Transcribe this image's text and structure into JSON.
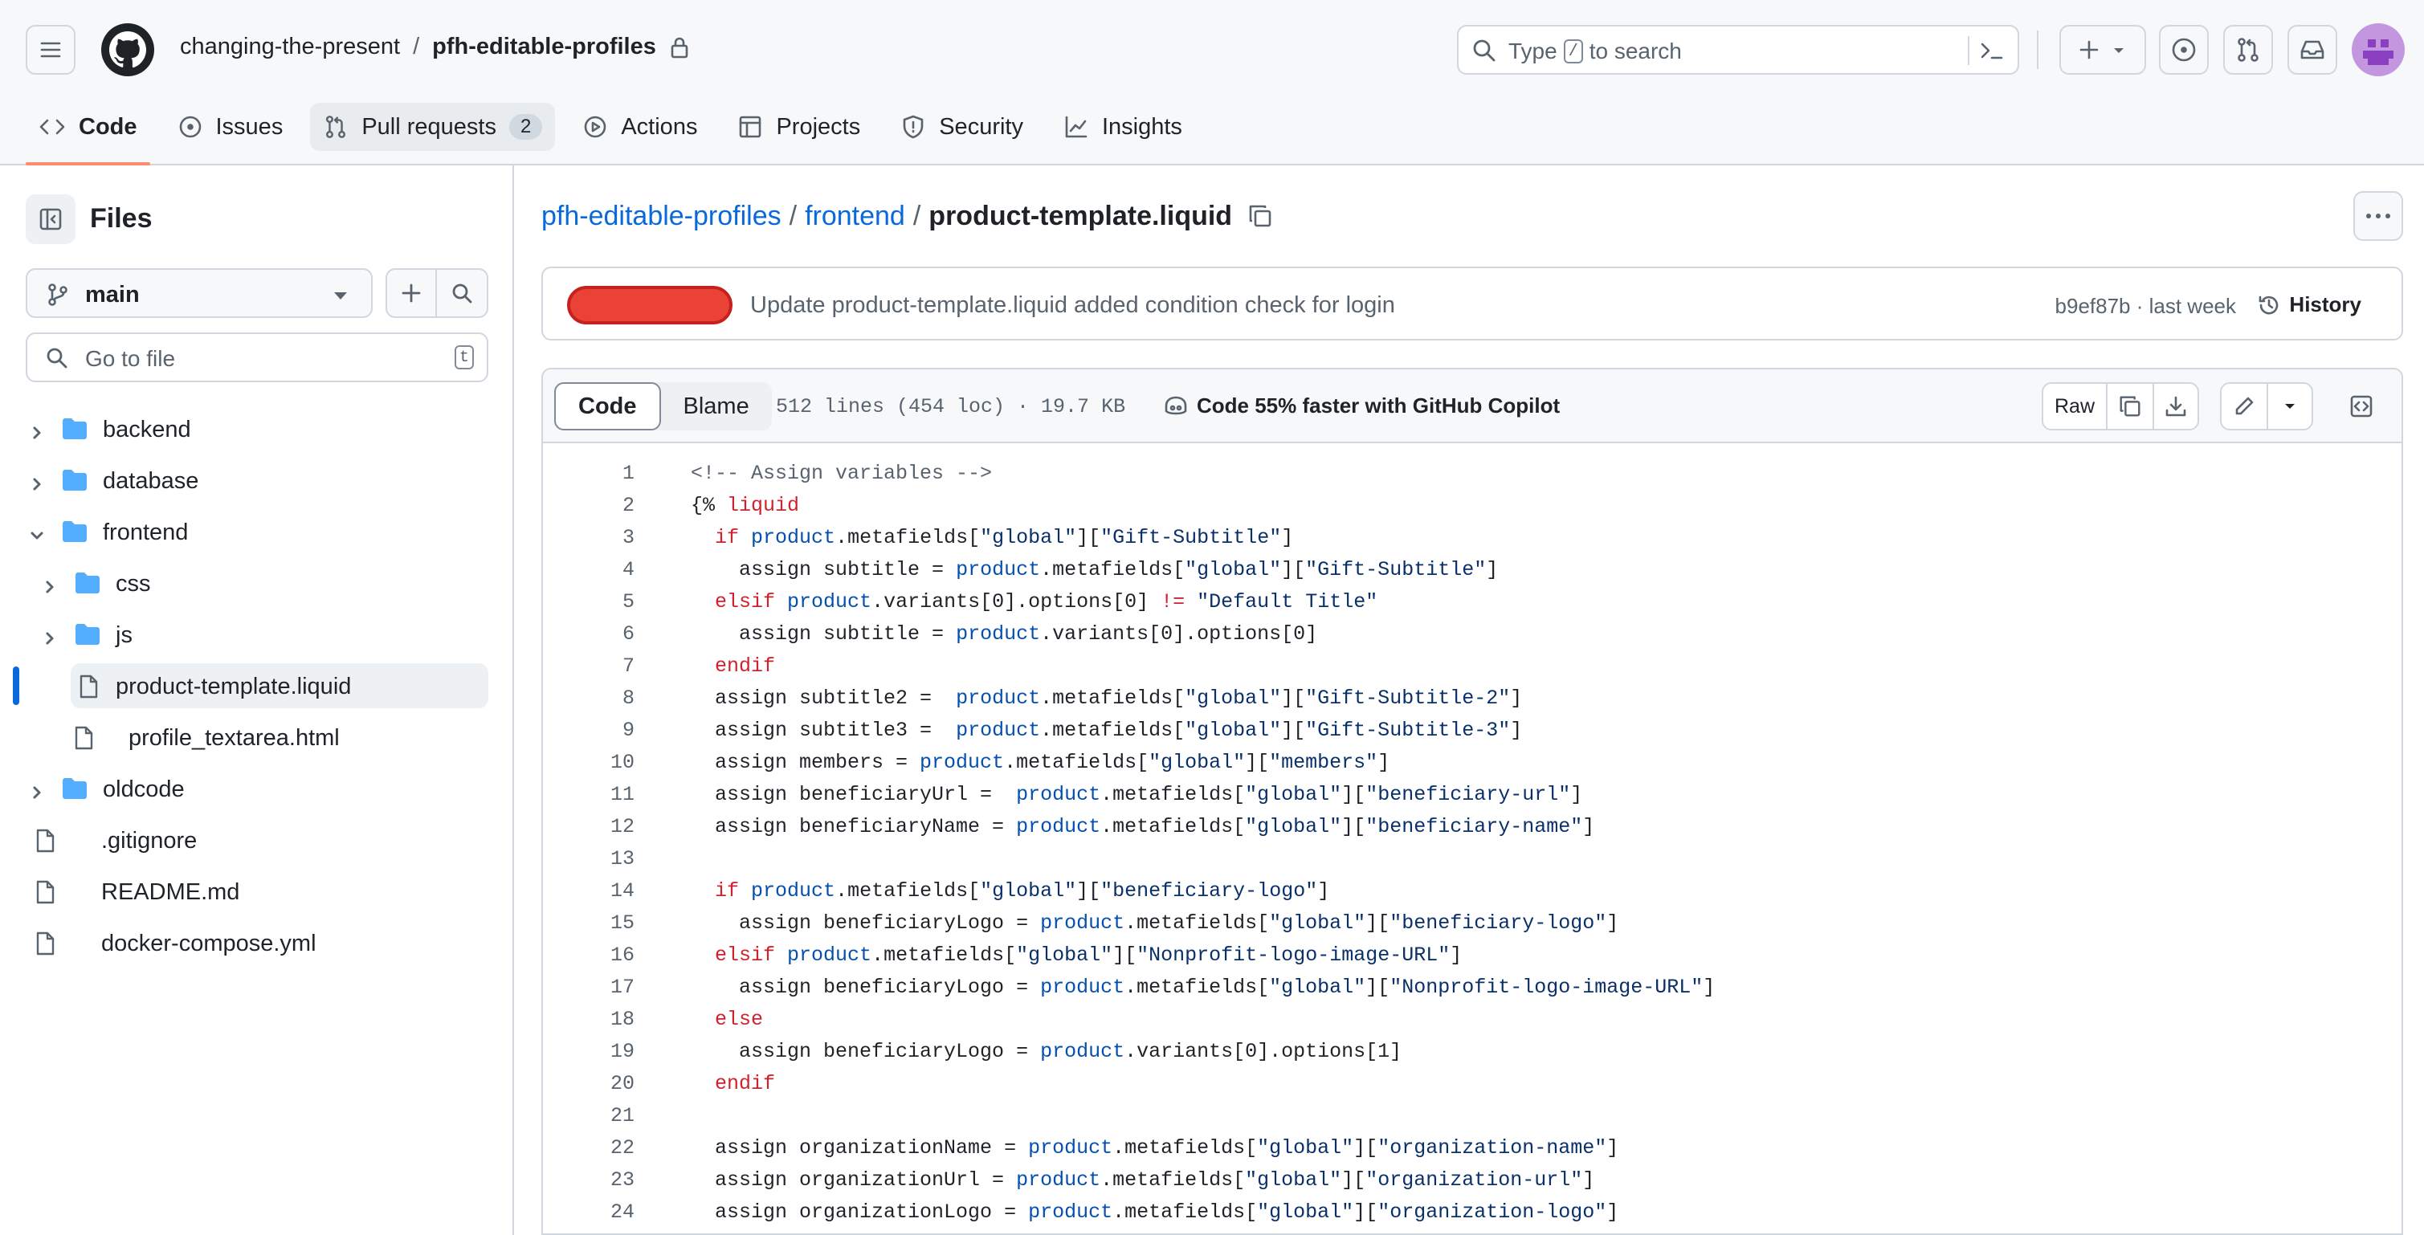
{
  "header": {
    "owner": "changing-the-present",
    "separator": "/",
    "repo": "pfh-editable-profiles",
    "search": {
      "prefix": "Type",
      "key": "/",
      "suffix": "to search"
    }
  },
  "tabs": [
    {
      "label": "Code"
    },
    {
      "label": "Issues"
    },
    {
      "label": "Pull requests",
      "count": "2"
    },
    {
      "label": "Actions"
    },
    {
      "label": "Projects"
    },
    {
      "label": "Security"
    },
    {
      "label": "Insights"
    }
  ],
  "sidebar": {
    "title": "Files",
    "branch": "main",
    "goto_placeholder": "Go to file",
    "goto_key": "t",
    "tree": [
      {
        "label": "backend",
        "type": "folder",
        "expanded": false,
        "depth": 0
      },
      {
        "label": "database",
        "type": "folder",
        "expanded": false,
        "depth": 0
      },
      {
        "label": "frontend",
        "type": "folder",
        "expanded": true,
        "depth": 0
      },
      {
        "label": "css",
        "type": "folder",
        "expanded": false,
        "depth": 1
      },
      {
        "label": "js",
        "type": "folder",
        "expanded": false,
        "depth": 1
      },
      {
        "label": "product-template.liquid",
        "type": "file",
        "selected": true,
        "depth": 1
      },
      {
        "label": "profile_textarea.html",
        "type": "file",
        "depth": 1
      },
      {
        "label": "oldcode",
        "type": "folder",
        "expanded": false,
        "depth": 0
      },
      {
        "label": ".gitignore",
        "type": "file",
        "depth": 0
      },
      {
        "label": "README.md",
        "type": "file",
        "depth": 0
      },
      {
        "label": "docker-compose.yml",
        "type": "file",
        "depth": 0
      }
    ]
  },
  "breadcrumb": {
    "repo": "pfh-editable-profiles",
    "folder": "frontend",
    "file": "product-template.liquid",
    "sep": "/"
  },
  "commit": {
    "message": "Update product-template.liquid added condition check for login",
    "sha_time": "b9ef87b · last week",
    "history": "History"
  },
  "file": {
    "code_tab": "Code",
    "blame_tab": "Blame",
    "meta": "512 lines (454 loc) · 19.7 KB",
    "copilot": "Code 55% faster with GitHub Copilot",
    "raw": "Raw"
  },
  "colors": {
    "accent": "#0969da",
    "tab_underline": "#fd8c73",
    "folder": "#54aeff",
    "keyword": "#cf222e",
    "object": "#0550ae",
    "string": "#0a3069"
  },
  "code_lines": [
    [
      [
        "c",
        "<!-- Assign variables -->"
      ]
    ],
    [
      [
        "p",
        "{% "
      ],
      [
        "k",
        "liquid"
      ]
    ],
    [
      [
        "p",
        "  "
      ],
      [
        "k",
        "if"
      ],
      [
        "p",
        " "
      ],
      [
        "o",
        "product"
      ],
      [
        "p",
        ".metafields["
      ],
      [
        "s",
        "\"global\""
      ],
      [
        "p",
        "]["
      ],
      [
        "s",
        "\"Gift-Subtitle\""
      ],
      [
        "p",
        "]"
      ]
    ],
    [
      [
        "p",
        "    assign subtitle = "
      ],
      [
        "o",
        "product"
      ],
      [
        "p",
        ".metafields["
      ],
      [
        "s",
        "\"global\""
      ],
      [
        "p",
        "]["
      ],
      [
        "s",
        "\"Gift-Subtitle\""
      ],
      [
        "p",
        "]"
      ]
    ],
    [
      [
        "p",
        "  "
      ],
      [
        "k",
        "elsif"
      ],
      [
        "p",
        " "
      ],
      [
        "o",
        "product"
      ],
      [
        "p",
        ".variants[0].options[0] "
      ],
      [
        "k",
        "!="
      ],
      [
        "p",
        " "
      ],
      [
        "s",
        "\"Default Title\""
      ]
    ],
    [
      [
        "p",
        "    assign subtitle = "
      ],
      [
        "o",
        "product"
      ],
      [
        "p",
        ".variants[0].options[0]"
      ]
    ],
    [
      [
        "p",
        "  "
      ],
      [
        "k",
        "endif"
      ]
    ],
    [
      [
        "p",
        "  assign subtitle2 =  "
      ],
      [
        "o",
        "product"
      ],
      [
        "p",
        ".metafields["
      ],
      [
        "s",
        "\"global\""
      ],
      [
        "p",
        "]["
      ],
      [
        "s",
        "\"Gift-Subtitle-2\""
      ],
      [
        "p",
        "]"
      ]
    ],
    [
      [
        "p",
        "  assign subtitle3 =  "
      ],
      [
        "o",
        "product"
      ],
      [
        "p",
        ".metafields["
      ],
      [
        "s",
        "\"global\""
      ],
      [
        "p",
        "]["
      ],
      [
        "s",
        "\"Gift-Subtitle-3\""
      ],
      [
        "p",
        "]"
      ]
    ],
    [
      [
        "p",
        "  assign members = "
      ],
      [
        "o",
        "product"
      ],
      [
        "p",
        ".metafields["
      ],
      [
        "s",
        "\"global\""
      ],
      [
        "p",
        "]["
      ],
      [
        "s",
        "\"members\""
      ],
      [
        "p",
        "]"
      ]
    ],
    [
      [
        "p",
        "  assign beneficiaryUrl =  "
      ],
      [
        "o",
        "product"
      ],
      [
        "p",
        ".metafields["
      ],
      [
        "s",
        "\"global\""
      ],
      [
        "p",
        "]["
      ],
      [
        "s",
        "\"beneficiary-url\""
      ],
      [
        "p",
        "]"
      ]
    ],
    [
      [
        "p",
        "  assign beneficiaryName = "
      ],
      [
        "o",
        "product"
      ],
      [
        "p",
        ".metafields["
      ],
      [
        "s",
        "\"global\""
      ],
      [
        "p",
        "]["
      ],
      [
        "s",
        "\"beneficiary-name\""
      ],
      [
        "p",
        "]"
      ]
    ],
    [
      [
        "p",
        ""
      ]
    ],
    [
      [
        "p",
        "  "
      ],
      [
        "k",
        "if"
      ],
      [
        "p",
        " "
      ],
      [
        "o",
        "product"
      ],
      [
        "p",
        ".metafields["
      ],
      [
        "s",
        "\"global\""
      ],
      [
        "p",
        "]["
      ],
      [
        "s",
        "\"beneficiary-logo\""
      ],
      [
        "p",
        "]"
      ]
    ],
    [
      [
        "p",
        "    assign beneficiaryLogo = "
      ],
      [
        "o",
        "product"
      ],
      [
        "p",
        ".metafields["
      ],
      [
        "s",
        "\"global\""
      ],
      [
        "p",
        "]["
      ],
      [
        "s",
        "\"beneficiary-logo\""
      ],
      [
        "p",
        "]"
      ]
    ],
    [
      [
        "p",
        "  "
      ],
      [
        "k",
        "elsif"
      ],
      [
        "p",
        " "
      ],
      [
        "o",
        "product"
      ],
      [
        "p",
        ".metafields["
      ],
      [
        "s",
        "\"global\""
      ],
      [
        "p",
        "]["
      ],
      [
        "s",
        "\"Nonprofit-logo-image-URL\""
      ],
      [
        "p",
        "]"
      ]
    ],
    [
      [
        "p",
        "    assign beneficiaryLogo = "
      ],
      [
        "o",
        "product"
      ],
      [
        "p",
        ".metafields["
      ],
      [
        "s",
        "\"global\""
      ],
      [
        "p",
        "]["
      ],
      [
        "s",
        "\"Nonprofit-logo-image-URL\""
      ],
      [
        "p",
        "]"
      ]
    ],
    [
      [
        "p",
        "  "
      ],
      [
        "k",
        "else"
      ]
    ],
    [
      [
        "p",
        "    assign beneficiaryLogo = "
      ],
      [
        "o",
        "product"
      ],
      [
        "p",
        ".variants[0].options[1]"
      ]
    ],
    [
      [
        "p",
        "  "
      ],
      [
        "k",
        "endif"
      ]
    ],
    [
      [
        "p",
        ""
      ]
    ],
    [
      [
        "p",
        "  assign organizationName = "
      ],
      [
        "o",
        "product"
      ],
      [
        "p",
        ".metafields["
      ],
      [
        "s",
        "\"global\""
      ],
      [
        "p",
        "]["
      ],
      [
        "s",
        "\"organization-name\""
      ],
      [
        "p",
        "]"
      ]
    ],
    [
      [
        "p",
        "  assign organizationUrl = "
      ],
      [
        "o",
        "product"
      ],
      [
        "p",
        ".metafields["
      ],
      [
        "s",
        "\"global\""
      ],
      [
        "p",
        "]["
      ],
      [
        "s",
        "\"organization-url\""
      ],
      [
        "p",
        "]"
      ]
    ],
    [
      [
        "p",
        "  assign organizationLogo = "
      ],
      [
        "o",
        "product"
      ],
      [
        "p",
        ".metafields["
      ],
      [
        "s",
        "\"global\""
      ],
      [
        "p",
        "]["
      ],
      [
        "s",
        "\"organization-logo\""
      ],
      [
        "p",
        "]"
      ]
    ]
  ]
}
